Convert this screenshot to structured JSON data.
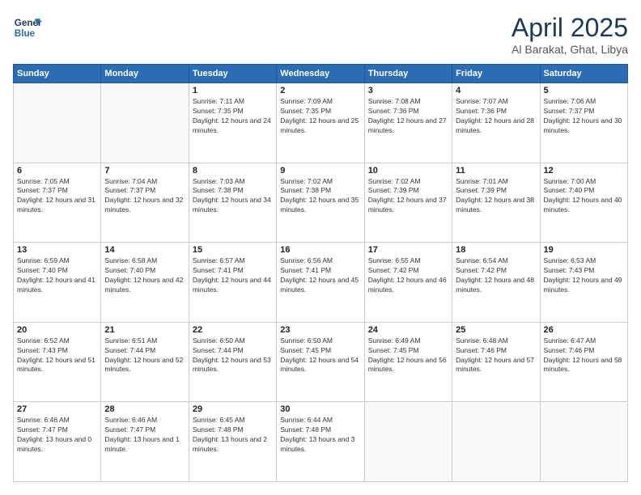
{
  "header": {
    "logo_line1": "General",
    "logo_line2": "Blue",
    "month": "April 2025",
    "location": "Al Barakat, Ghat, Libya"
  },
  "weekdays": [
    "Sunday",
    "Monday",
    "Tuesday",
    "Wednesday",
    "Thursday",
    "Friday",
    "Saturday"
  ],
  "weeks": [
    [
      {
        "day": "",
        "sunrise": "",
        "sunset": "",
        "daylight": ""
      },
      {
        "day": "",
        "sunrise": "",
        "sunset": "",
        "daylight": ""
      },
      {
        "day": "1",
        "sunrise": "Sunrise: 7:11 AM",
        "sunset": "Sunset: 7:35 PM",
        "daylight": "Daylight: 12 hours and 24 minutes."
      },
      {
        "day": "2",
        "sunrise": "Sunrise: 7:09 AM",
        "sunset": "Sunset: 7:35 PM",
        "daylight": "Daylight: 12 hours and 25 minutes."
      },
      {
        "day": "3",
        "sunrise": "Sunrise: 7:08 AM",
        "sunset": "Sunset: 7:36 PM",
        "daylight": "Daylight: 12 hours and 27 minutes."
      },
      {
        "day": "4",
        "sunrise": "Sunrise: 7:07 AM",
        "sunset": "Sunset: 7:36 PM",
        "daylight": "Daylight: 12 hours and 28 minutes."
      },
      {
        "day": "5",
        "sunrise": "Sunrise: 7:06 AM",
        "sunset": "Sunset: 7:37 PM",
        "daylight": "Daylight: 12 hours and 30 minutes."
      }
    ],
    [
      {
        "day": "6",
        "sunrise": "Sunrise: 7:05 AM",
        "sunset": "Sunset: 7:37 PM",
        "daylight": "Daylight: 12 hours and 31 minutes."
      },
      {
        "day": "7",
        "sunrise": "Sunrise: 7:04 AM",
        "sunset": "Sunset: 7:37 PM",
        "daylight": "Daylight: 12 hours and 32 minutes."
      },
      {
        "day": "8",
        "sunrise": "Sunrise: 7:03 AM",
        "sunset": "Sunset: 7:38 PM",
        "daylight": "Daylight: 12 hours and 34 minutes."
      },
      {
        "day": "9",
        "sunrise": "Sunrise: 7:02 AM",
        "sunset": "Sunset: 7:38 PM",
        "daylight": "Daylight: 12 hours and 35 minutes."
      },
      {
        "day": "10",
        "sunrise": "Sunrise: 7:02 AM",
        "sunset": "Sunset: 7:39 PM",
        "daylight": "Daylight: 12 hours and 37 minutes."
      },
      {
        "day": "11",
        "sunrise": "Sunrise: 7:01 AM",
        "sunset": "Sunset: 7:39 PM",
        "daylight": "Daylight: 12 hours and 38 minutes."
      },
      {
        "day": "12",
        "sunrise": "Sunrise: 7:00 AM",
        "sunset": "Sunset: 7:40 PM",
        "daylight": "Daylight: 12 hours and 40 minutes."
      }
    ],
    [
      {
        "day": "13",
        "sunrise": "Sunrise: 6:59 AM",
        "sunset": "Sunset: 7:40 PM",
        "daylight": "Daylight: 12 hours and 41 minutes."
      },
      {
        "day": "14",
        "sunrise": "Sunrise: 6:58 AM",
        "sunset": "Sunset: 7:40 PM",
        "daylight": "Daylight: 12 hours and 42 minutes."
      },
      {
        "day": "15",
        "sunrise": "Sunrise: 6:57 AM",
        "sunset": "Sunset: 7:41 PM",
        "daylight": "Daylight: 12 hours and 44 minutes."
      },
      {
        "day": "16",
        "sunrise": "Sunrise: 6:56 AM",
        "sunset": "Sunset: 7:41 PM",
        "daylight": "Daylight: 12 hours and 45 minutes."
      },
      {
        "day": "17",
        "sunrise": "Sunrise: 6:55 AM",
        "sunset": "Sunset: 7:42 PM",
        "daylight": "Daylight: 12 hours and 46 minutes."
      },
      {
        "day": "18",
        "sunrise": "Sunrise: 6:54 AM",
        "sunset": "Sunset: 7:42 PM",
        "daylight": "Daylight: 12 hours and 48 minutes."
      },
      {
        "day": "19",
        "sunrise": "Sunrise: 6:53 AM",
        "sunset": "Sunset: 7:43 PM",
        "daylight": "Daylight: 12 hours and 49 minutes."
      }
    ],
    [
      {
        "day": "20",
        "sunrise": "Sunrise: 6:52 AM",
        "sunset": "Sunset: 7:43 PM",
        "daylight": "Daylight: 12 hours and 51 minutes."
      },
      {
        "day": "21",
        "sunrise": "Sunrise: 6:51 AM",
        "sunset": "Sunset: 7:44 PM",
        "daylight": "Daylight: 12 hours and 52 minutes."
      },
      {
        "day": "22",
        "sunrise": "Sunrise: 6:50 AM",
        "sunset": "Sunset: 7:44 PM",
        "daylight": "Daylight: 12 hours and 53 minutes."
      },
      {
        "day": "23",
        "sunrise": "Sunrise: 6:50 AM",
        "sunset": "Sunset: 7:45 PM",
        "daylight": "Daylight: 12 hours and 54 minutes."
      },
      {
        "day": "24",
        "sunrise": "Sunrise: 6:49 AM",
        "sunset": "Sunset: 7:45 PM",
        "daylight": "Daylight: 12 hours and 56 minutes."
      },
      {
        "day": "25",
        "sunrise": "Sunrise: 6:48 AM",
        "sunset": "Sunset: 7:46 PM",
        "daylight": "Daylight: 12 hours and 57 minutes."
      },
      {
        "day": "26",
        "sunrise": "Sunrise: 6:47 AM",
        "sunset": "Sunset: 7:46 PM",
        "daylight": "Daylight: 12 hours and 58 minutes."
      }
    ],
    [
      {
        "day": "27",
        "sunrise": "Sunrise: 6:46 AM",
        "sunset": "Sunset: 7:47 PM",
        "daylight": "Daylight: 13 hours and 0 minutes."
      },
      {
        "day": "28",
        "sunrise": "Sunrise: 6:46 AM",
        "sunset": "Sunset: 7:47 PM",
        "daylight": "Daylight: 13 hours and 1 minute."
      },
      {
        "day": "29",
        "sunrise": "Sunrise: 6:45 AM",
        "sunset": "Sunset: 7:48 PM",
        "daylight": "Daylight: 13 hours and 2 minutes."
      },
      {
        "day": "30",
        "sunrise": "Sunrise: 6:44 AM",
        "sunset": "Sunset: 7:48 PM",
        "daylight": "Daylight: 13 hours and 3 minutes."
      },
      {
        "day": "",
        "sunrise": "",
        "sunset": "",
        "daylight": ""
      },
      {
        "day": "",
        "sunrise": "",
        "sunset": "",
        "daylight": ""
      },
      {
        "day": "",
        "sunrise": "",
        "sunset": "",
        "daylight": ""
      }
    ]
  ]
}
